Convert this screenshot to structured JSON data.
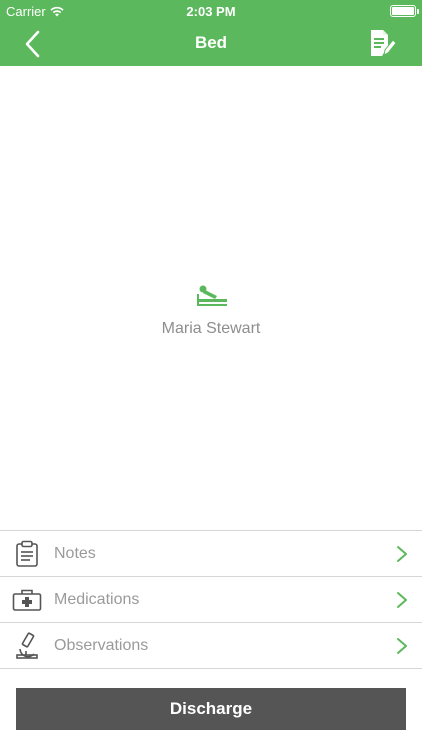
{
  "status_bar": {
    "carrier": "Carrier",
    "time": "2:03 PM"
  },
  "nav": {
    "title": "Bed",
    "back_icon": "chevron-left-icon",
    "action_icon": "edit-document-icon"
  },
  "patient": {
    "name": "Maria Stewart",
    "icon": "hospital-bed-icon"
  },
  "menu": {
    "items": [
      {
        "label": "Notes",
        "icon": "clipboard-icon"
      },
      {
        "label": "Medications",
        "icon": "first-aid-kit-icon"
      },
      {
        "label": "Observations",
        "icon": "microscope-icon"
      }
    ]
  },
  "actions": {
    "discharge_label": "Discharge"
  },
  "colors": {
    "accent": "#5cb85c",
    "button": "#555555",
    "text_muted": "#9a9a9a"
  }
}
